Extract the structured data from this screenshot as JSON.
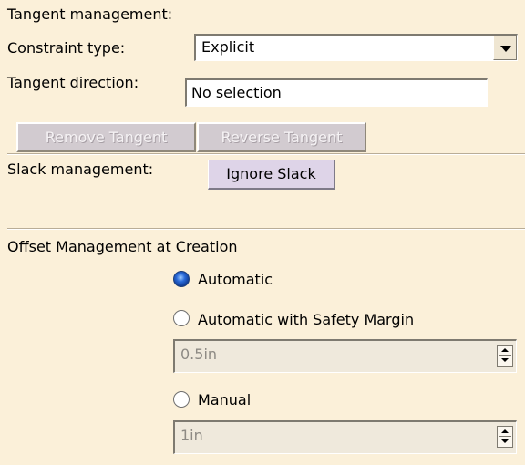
{
  "tangent_management": {
    "heading": "Tangent management:",
    "constraint_type_label": "Constraint type:",
    "constraint_type_value": "Explicit",
    "tangent_direction_label": "Tangent direction:",
    "tangent_direction_value": "No selection",
    "remove_tangent_label": "Remove Tangent",
    "reverse_tangent_label": "Reverse Tangent"
  },
  "slack_management": {
    "label": "Slack management:",
    "ignore_slack_label": "Ignore Slack"
  },
  "offset_management": {
    "heading": "Offset Management at Creation",
    "options": [
      {
        "label": "Automatic",
        "selected": true
      },
      {
        "label": "Automatic with Safety Margin",
        "selected": false
      },
      {
        "label": "Manual",
        "selected": false
      }
    ],
    "safety_margin_value": "0.5in",
    "manual_value": "1in"
  },
  "colors": {
    "background": "#fbf0d9",
    "radio_selected": "#2a6ad8"
  },
  "icons": [
    "dropdown-arrow-icon",
    "spinner-up-icon",
    "spinner-down-icon"
  ]
}
